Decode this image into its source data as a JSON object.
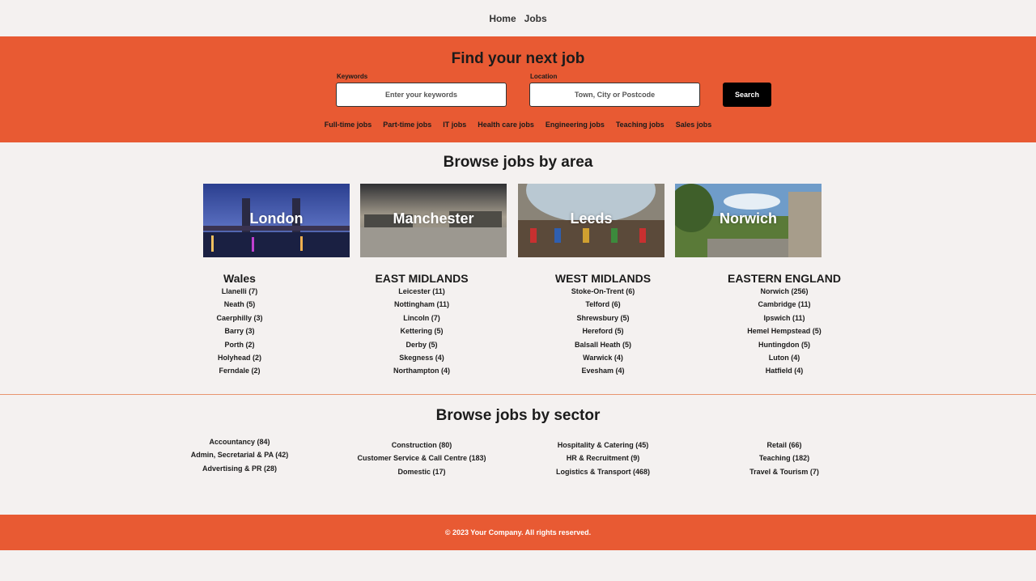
{
  "nav": {
    "home": "Home",
    "jobs": "Jobs"
  },
  "hero": {
    "title": "Find your next job",
    "keywords_label": "Keywords",
    "keywords_placeholder": "Enter your keywords",
    "location_label": "Location",
    "location_placeholder": "Town, City or Postcode",
    "search_label": "Search",
    "quick_links": [
      "Full-time jobs",
      "Part-time jobs",
      "IT jobs",
      "Health care jobs",
      "Engineering jobs",
      "Teaching jobs",
      "Sales jobs"
    ]
  },
  "areas": {
    "title": "Browse jobs by area",
    "cards": [
      "London",
      "Manchester",
      "Leeds",
      "Norwich"
    ],
    "regions": [
      {
        "name": "Wales",
        "towns": [
          "Llanelli (7)",
          "Neath (5)",
          "Caerphilly (3)",
          "Barry (3)",
          "Porth (2)",
          "Holyhead (2)",
          "Ferndale (2)"
        ]
      },
      {
        "name": "EAST MIDLANDS",
        "towns": [
          "Leicester (11)",
          "Nottingham (11)",
          "Lincoln (7)",
          "Kettering (5)",
          "Derby (5)",
          "Skegness (4)",
          "Northampton (4)"
        ]
      },
      {
        "name": "WEST MIDLANDS",
        "towns": [
          "Stoke-On-Trent (6)",
          "Telford (6)",
          "Shrewsbury (5)",
          "Hereford (5)",
          "Balsall Heath (5)",
          "Warwick (4)",
          "Evesham (4)"
        ]
      },
      {
        "name": "EASTERN ENGLAND",
        "towns": [
          "Norwich (256)",
          "Cambridge (11)",
          "Ipswich (11)",
          "Hemel Hempstead (5)",
          "Huntingdon (5)",
          "Luton (4)",
          "Hatfield (4)"
        ]
      }
    ]
  },
  "sectors": {
    "title": "Browse jobs by sector",
    "columns": [
      [
        "Accountancy (84)",
        "Admin, Secretarial & PA (42)",
        "Advertising & PR (28)"
      ],
      [
        "Construction (80)",
        "Customer Service & Call Centre (183)",
        "Domestic (17)"
      ],
      [
        "Hospitality & Catering (45)",
        "HR & Recruitment (9)",
        "Logistics & Transport (468)"
      ],
      [
        "Retail (66)",
        "Teaching (182)",
        "Travel & Tourism (7)"
      ]
    ]
  },
  "footer": {
    "copyright": "© 2023 Your Company. All rights reserved."
  },
  "colors": {
    "brand_orange": "#e85a33",
    "page_bg": "#f4f1f0",
    "button_black": "#000000"
  },
  "icons": []
}
